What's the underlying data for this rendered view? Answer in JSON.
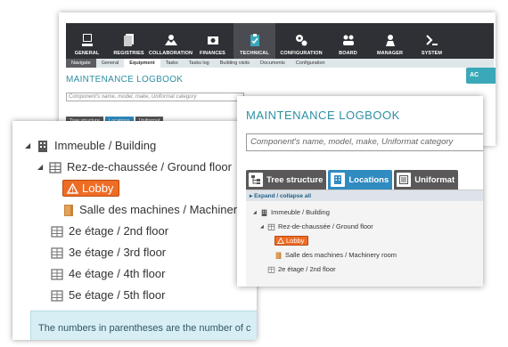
{
  "nav": {
    "items": [
      {
        "label": "GENERAL",
        "icon": "monitor-icon"
      },
      {
        "label": "REGISTRIES",
        "icon": "documents-icon"
      },
      {
        "label": "COLLABORATION",
        "icon": "hands-icon"
      },
      {
        "label": "FINANCES",
        "icon": "money-icon"
      },
      {
        "label": "TECHNICAL",
        "icon": "clipboard-icon",
        "active": true
      },
      {
        "label": "CONFIGURATION",
        "icon": "gears-icon"
      },
      {
        "label": "BOARD",
        "icon": "people-icon"
      },
      {
        "label": "MANAGER",
        "icon": "manager-icon"
      },
      {
        "label": "SYSTEM",
        "icon": "terminal-icon"
      }
    ],
    "subnav": [
      "Navigate",
      "General",
      "Equipment",
      "Tasks",
      "Tasks log",
      "Building visits",
      "Documents",
      "Configuration"
    ]
  },
  "page": {
    "title": "MAINTENANCE LOGBOOK",
    "search_placeholder": "Component's name, model, make, Uniformat category",
    "add_button": "AC",
    "tabs": {
      "tree": "Tree structure",
      "locations": "Locations",
      "uniformat": "Uniformat"
    },
    "expand_collapse": "Expand / collapse all"
  },
  "tree": {
    "building": "Immeuble / Building",
    "ground_floor": "Rez-de-chaussée / Ground floor",
    "lobby": "Lobby",
    "machinery_room": "Salle des machines / Machinery room",
    "floor2": "2e étage / 2nd floor",
    "floor3": "3e étage / 3rd floor",
    "floor4": "4e étage / 4th floor",
    "floor5": "5e étage / 5th floor"
  },
  "info": {
    "text": "The numbers in parentheses are the number of c"
  },
  "colors": {
    "accent": "#2e8fa3",
    "tab_active": "#2f8bc0",
    "lobby": "#ef6c25",
    "nav_bg": "#2f3035"
  }
}
